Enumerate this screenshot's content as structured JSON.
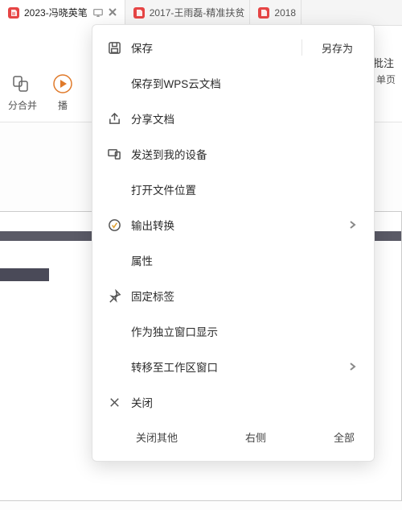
{
  "tabs": [
    {
      "title": "2023-冯晓英笔"
    },
    {
      "title": "2017-王雨磊-精准扶贫"
    },
    {
      "title": "2018"
    }
  ],
  "ribbon": {
    "merge_label": "分合并",
    "play_label": "播",
    "single_page_label": "单页",
    "batch_label": "批注"
  },
  "menu": {
    "save": "保存",
    "save_as": "另存为",
    "save_to_cloud": "保存到WPS云文档",
    "share": "分享文档",
    "send_to_device": "发送到我的设备",
    "open_location": "打开文件位置",
    "export_convert": "输出转换",
    "properties": "属性",
    "pin_tab": "固定标签",
    "open_new_window": "作为独立窗口显示",
    "move_to_workspace": "转移至工作区窗口",
    "close": "关闭",
    "close_others": "关闭其他",
    "close_right": "右侧",
    "close_all": "全部"
  }
}
